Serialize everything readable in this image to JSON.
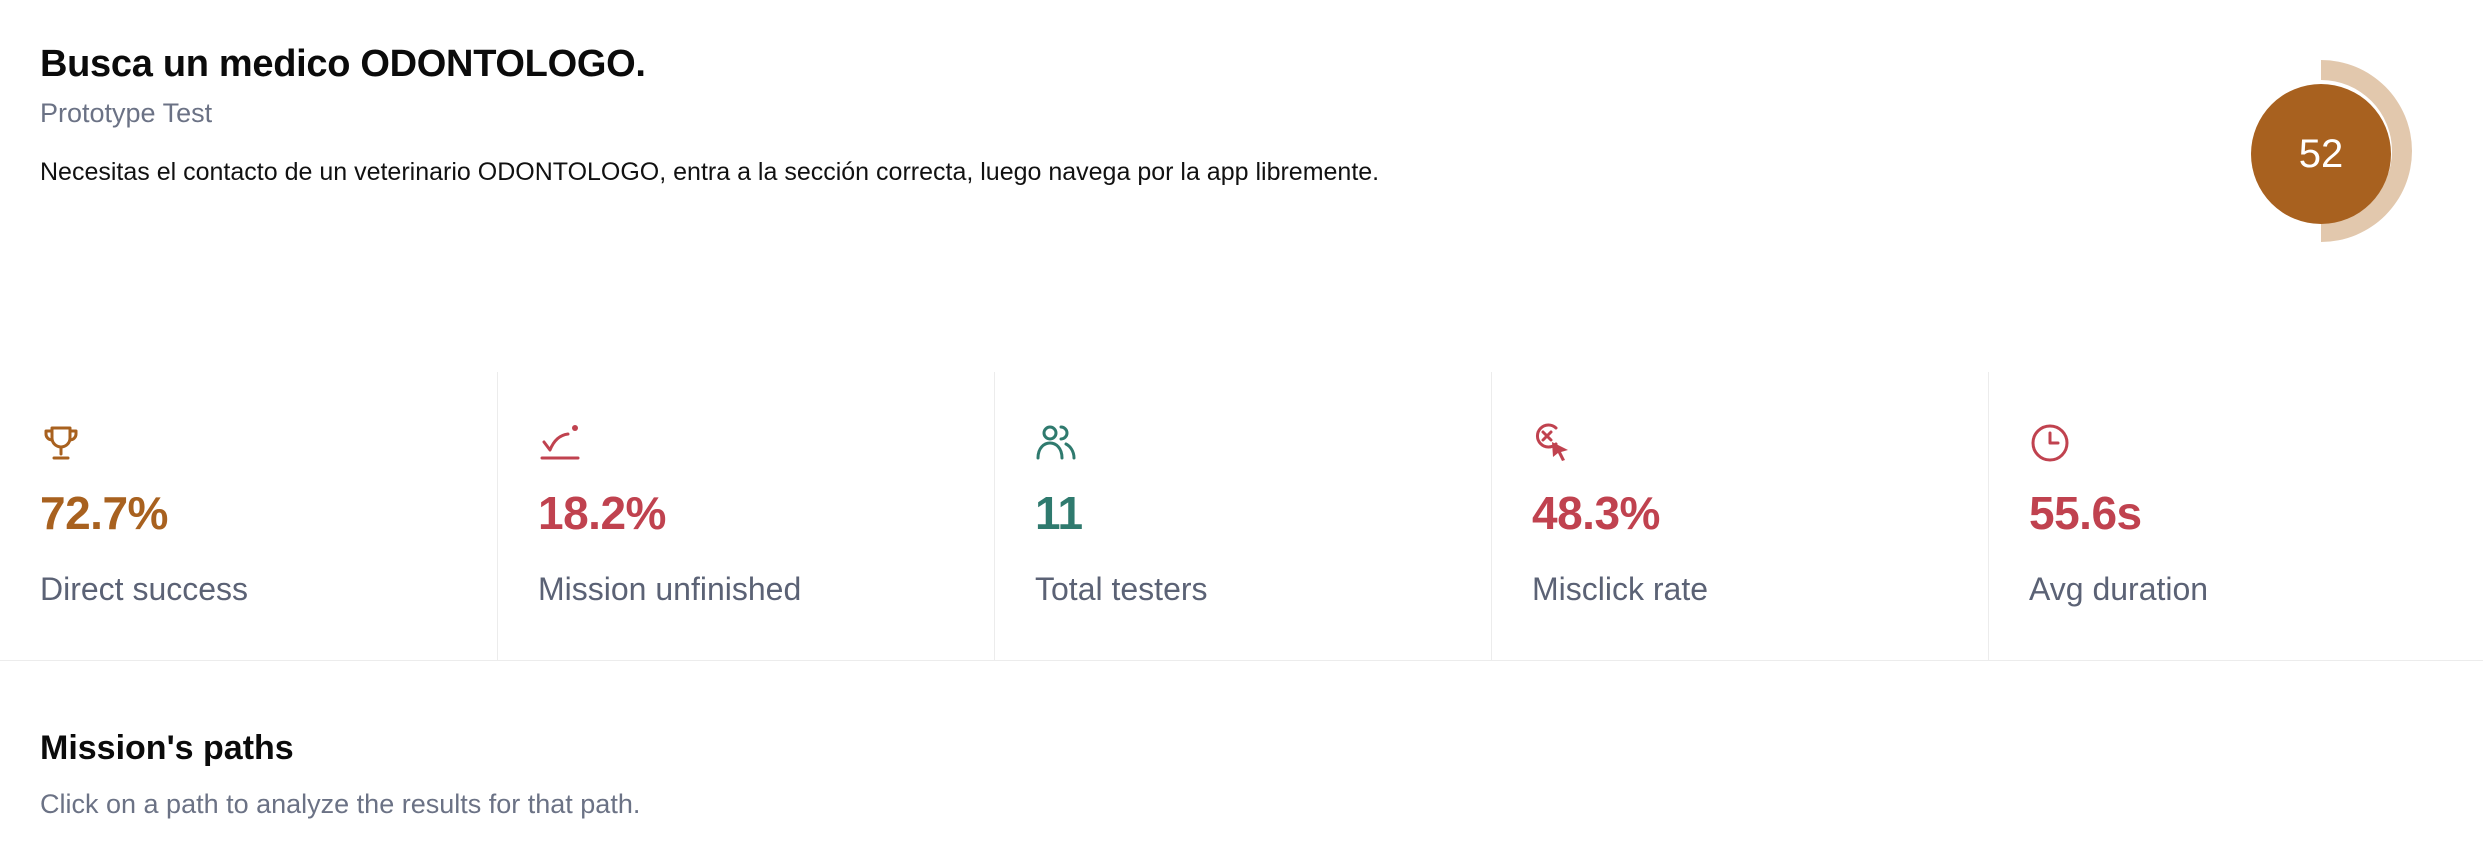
{
  "mission": {
    "title": "Busca un medico ODONTOLOGO.",
    "type": "Prototype Test",
    "description": "Necesitas el contacto de un veterinario ODONTOLOGO, entra a la sección correcta, luego navega por la app libremente."
  },
  "score": {
    "value": "52",
    "fill_fraction": 0.52,
    "color": "#a8611f",
    "ring_color": "#e2c8ad"
  },
  "metrics": [
    {
      "icon": "trophy-icon",
      "value": "72.7%",
      "label": "Direct success",
      "color": "#a8611f"
    },
    {
      "icon": "mission-unfinished-icon",
      "value": "18.2%",
      "label": "Mission unfinished",
      "color": "#c0424f"
    },
    {
      "icon": "users-icon",
      "value": "11",
      "label": "Total testers",
      "color": "#2f7a6e"
    },
    {
      "icon": "misclick-icon",
      "value": "48.3%",
      "label": "Misclick rate",
      "color": "#c0424f"
    },
    {
      "icon": "clock-icon",
      "value": "55.6s",
      "label": "Avg duration",
      "color": "#c0424f"
    }
  ],
  "paths": {
    "title": "Mission's paths",
    "subtitle": "Click on a path to analyze the results for that path."
  }
}
